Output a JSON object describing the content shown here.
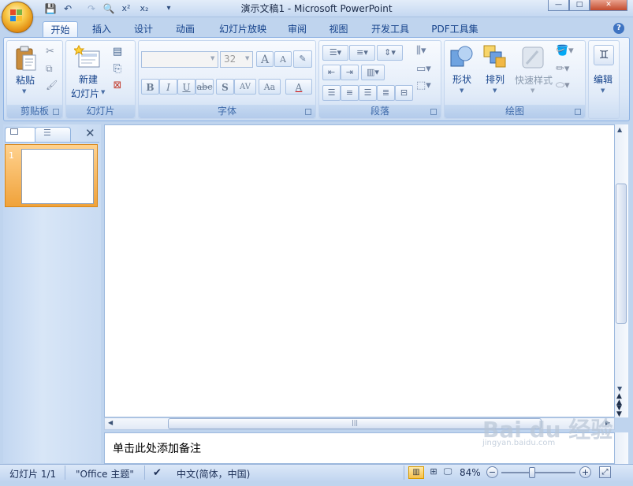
{
  "window": {
    "title": "演示文稿1 - Microsoft PowerPoint",
    "minimize": "—",
    "maximize": "□",
    "close": "✕"
  },
  "qat": {
    "save": "💾",
    "undo": "↶",
    "redo": "↷",
    "preview": "🔍",
    "sup": "x²",
    "sub": "x₂",
    "more": "▾"
  },
  "tabs": [
    "开始",
    "插入",
    "设计",
    "动画",
    "幻灯片放映",
    "审阅",
    "视图",
    "开发工具",
    "PDF工具集"
  ],
  "help": "?",
  "ribbon": {
    "clipboard": {
      "label": "剪贴板",
      "paste": "粘贴"
    },
    "slides": {
      "label": "幻灯片",
      "new_slide_1": "新建",
      "new_slide_2": "幻灯片"
    },
    "font": {
      "label": "字体",
      "font_size": "32",
      "bold": "B",
      "italic": "I",
      "underline": "U",
      "strike": "abc",
      "shadow": "S",
      "spacing": "AV",
      "case": "Aa",
      "color": "A",
      "grow": "A",
      "shrink": "A"
    },
    "paragraph": {
      "label": "段落"
    },
    "drawing": {
      "label": "绘图",
      "shapes": "形状",
      "arrange": "排列",
      "quick_styles": "快速样式"
    },
    "editing": {
      "label": "编辑"
    }
  },
  "slide_panel": {
    "thumb_number": "1"
  },
  "notes": {
    "placeholder": "单击此处添加备注"
  },
  "status": {
    "slide_count": "幻灯片 1/1",
    "theme": "\"Office 主题\"",
    "language": "中文(简体，中国)",
    "zoom": "84%",
    "zoom_level": 84
  },
  "watermark": {
    "brand": "Bai du 经验",
    "url": "jingyan.baidu.com"
  },
  "colors": {
    "accent": "#15428b",
    "ribbon": "#dbe7f7",
    "thumb_highlight": "#f0a23a"
  }
}
